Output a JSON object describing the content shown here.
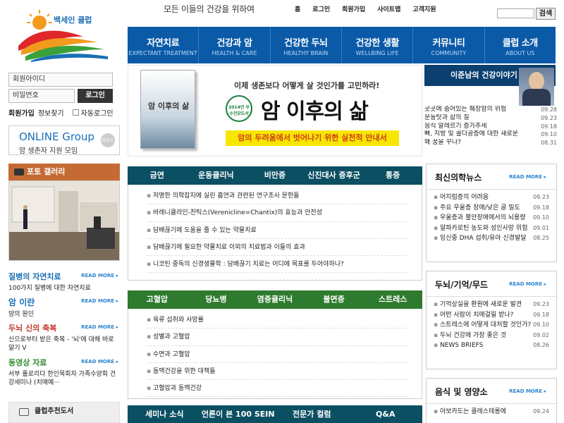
{
  "header": {
    "slogan": "모든 이들의 건강을 위하여",
    "logo_text": "백세인 클럽",
    "top_links": [
      "홈",
      "로그인",
      "회원가입",
      "사이트맵",
      "고객지원"
    ],
    "search_button": "검색"
  },
  "nav": [
    {
      "ko": "자연치료",
      "en": "EXPECTANT TREATMENT"
    },
    {
      "ko": "건강과 암",
      "en": "HEALTH & CARE"
    },
    {
      "ko": "건강한 두뇌",
      "en": "HEALTHY BRAIN"
    },
    {
      "ko": "건강한 생활",
      "en": "WELLBING LIFE"
    },
    {
      "ko": "커뮤니티",
      "en": "COMMUNITY"
    },
    {
      "ko": "클럽 소개",
      "en": "ABOUT US"
    }
  ],
  "login": {
    "id_placeholder": "회원아이디",
    "pw_placeholder": "비밀번호",
    "button": "로그인",
    "join": "회원가입",
    "find": "정보찾기",
    "auto": "자동로그인"
  },
  "online": {
    "title": "ONLINE Group",
    "sub": "암 생존자 지원 모임",
    "go": "GO+"
  },
  "gallery": {
    "title": "포토 갤러리"
  },
  "left_stories": [
    {
      "title": "질병의 자연치료",
      "desc": "100가지 질병에 대한 자연치료",
      "color": "#1a6fb5"
    },
    {
      "title": "암 이란",
      "desc": "암의 원인",
      "color": "#1a6fb5"
    },
    {
      "title": "두뇌 신의 축복",
      "desc": "신으로부터 받은 축복 - '뇌'에 대해 바로 알기 Ⅴ",
      "color": "#c0392b"
    },
    {
      "title": "동영상 자료",
      "desc": "서부 플로리다 한인목회자 가족수양회 건강세미나 (치매예···",
      "color": "#2e8b2e"
    }
  ],
  "read_more": "READ MORE ▸",
  "book_box": {
    "title": "클럽추천도서"
  },
  "banner": {
    "question": "이제 생존보다 어떻게 살 것인가를 고민하라!",
    "seal": "2014년 우수건강도서",
    "book_title": "암 이후의 삶",
    "big_title": "암 이후의 삶",
    "tagline": "암의 두려움에서 벗어나기 위한 실천적 안내서"
  },
  "lee": {
    "title": "이준남의 건강이야기",
    "items": [
      {
        "t": "곳곳에 숨어있는 췌장암의 위험",
        "d": "09.28"
      },
      {
        "t": "운동탓과 삶의 질",
        "d": "09.23"
      },
      {
        "t": "음식 알레르기 증가추세",
        "d": "09.18"
      },
      {
        "t": "빠, 지방 및 콜다공증에 대한 새로운",
        "d": "09.10"
      },
      {
        "t": "왜 꿈을 꾸나?",
        "d": "08.31"
      }
    ]
  },
  "panel1": {
    "tabs": [
      "금연",
      "운동클리닉",
      "비만증",
      "신진대사 증후군",
      "통증"
    ],
    "items": [
      "저명한 의학잡지에 실린 흡연과 관련된 연구조사 문헌들",
      "바레니클라인-찬틱스(Verenicline=Chantix)의 효능과 안전성",
      "담배끊기에 도움을 줄 수 있는 약물치료",
      "담배끊기에 필요한 약물치료 이외의 치료법과 이들의 효과",
      "니코틴 중독의 신경생물학 : 담배끊기 치료는 어디에 목표를 두어야하나?"
    ]
  },
  "panel2": {
    "tabs": [
      "고혈압",
      "당뇨병",
      "염증클리닉",
      "불면증",
      "스트레스"
    ],
    "items": [
      "육류 섭취와 사망률",
      "성별과 고혈압",
      "수면과 고혈압",
      "동맥건강을 위한 대책들",
      "고혈압과 동맥건강"
    ]
  },
  "panel3": {
    "tabs": [
      "세미나 소식",
      "언론이 본 100 SEIN",
      "전문가 컬럼",
      "Q&A"
    ]
  },
  "news": {
    "title": "최신의학뉴스",
    "items": [
      {
        "t": "어지럼증의 어려움",
        "d": "09.23"
      },
      {
        "t": "주요 우울증 장애/낮은 골 밀도",
        "d": "09.18"
      },
      {
        "t": "우울증과 불안장애에서의 뇌용량",
        "d": "09.10"
      },
      {
        "t": "알파카로틴 농도와 성인사망 위험",
        "d": "09.01"
      },
      {
        "t": "임신중 DHA 섭취/유아 신경발달",
        "d": "08.25"
      }
    ]
  },
  "brain": {
    "title": "두뇌/기억/무드",
    "items": [
      {
        "t": "기억상실을 환원에 새로운 발견",
        "d": "09.23"
      },
      {
        "t": "어떤 사람이 치매걸릴 받나?",
        "d": "09.18"
      },
      {
        "t": "스트레스에 어떻게 대처할 것인가?",
        "d": "09.10"
      },
      {
        "t": "두뇌 건강에 가장 좋은 것",
        "d": "09.02"
      },
      {
        "t": "NEWS BRIEFS",
        "d": "08.26"
      }
    ]
  },
  "food": {
    "title": "음식 및 영양소",
    "items": [
      {
        "t": "아보카도는 콜레스테롤에",
        "d": "09.24"
      }
    ]
  }
}
